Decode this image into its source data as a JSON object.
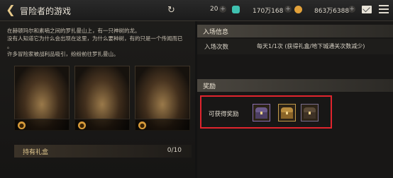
{
  "header": {
    "title": "冒险者的游戏",
    "currencies": [
      {
        "value": "20",
        "icon": "silver-coin-icon"
      },
      {
        "value": "170万168",
        "icon": "green-gem-icon"
      },
      {
        "value": "863万6388",
        "icon": "gold-coin-icon"
      }
    ]
  },
  "intro": {
    "lines": [
      "在赫顿玛尔和素喃之间的罗扎曼山上，有一只神树的龙。",
      "没有人知道它为什么会出现在这里，为什么要种树，有的只是一个传闻而已",
      "。",
      "许多冒险家被战利品吸引，纷纷前往罗扎曼山。"
    ]
  },
  "gift": {
    "label": "持有礼盒",
    "count": "0/10"
  },
  "entry": {
    "section_title": "入场信息",
    "label": "入场次数",
    "value": "每天1/1次 (获得礼盒/地下城通关次数减少)"
  },
  "reward": {
    "section_title": "奖励",
    "label": "可获得奖励",
    "chests": [
      "purple-chest-icon",
      "gold-chest-icon",
      "dark-chest-icon"
    ]
  },
  "colors": {
    "accent": "#e3c98f",
    "highlight": "#e0242d"
  }
}
